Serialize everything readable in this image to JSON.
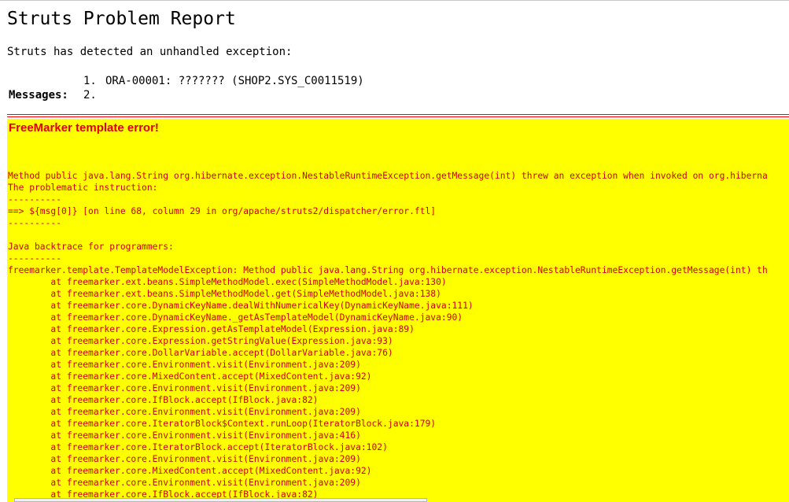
{
  "page": {
    "title": "Struts Problem Report",
    "intro": "Struts has detected an unhandled exception:",
    "messages_label": "Messages:",
    "messages": [
      {
        "num": "1.",
        "text": "ORA-00001: ??????? (SHOP2.SYS_C0011519)"
      },
      {
        "num": "2.",
        "text": ""
      }
    ]
  },
  "freemarker": {
    "heading": "FreeMarker template error!",
    "background_color": "#ffff00",
    "text_color": "#d00000",
    "lines": [
      "Method public java.lang.String org.hibernate.exception.NestableRuntimeException.getMessage(int) threw an exception when invoked on org.hiberna",
      "The problematic instruction:",
      "----------",
      "==> ${msg[0]} [on line 68, column 29 in org/apache/struts2/dispatcher/error.ftl]",
      "----------",
      "",
      "Java backtrace for programmers:",
      "----------",
      "freemarker.template.TemplateModelException: Method public java.lang.String org.hibernate.exception.NestableRuntimeException.getMessage(int) th",
      "        at freemarker.ext.beans.SimpleMethodModel.exec(SimpleMethodModel.java:130)",
      "        at freemarker.ext.beans.SimpleMethodModel.get(SimpleMethodModel.java:138)",
      "        at freemarker.core.DynamicKeyName.dealWithNumericalKey(DynamicKeyName.java:111)",
      "        at freemarker.core.DynamicKeyName._getAsTemplateModel(DynamicKeyName.java:90)",
      "        at freemarker.core.Expression.getAsTemplateModel(Expression.java:89)",
      "        at freemarker.core.Expression.getStringValue(Expression.java:93)",
      "        at freemarker.core.DollarVariable.accept(DollarVariable.java:76)",
      "        at freemarker.core.Environment.visit(Environment.java:209)",
      "        at freemarker.core.MixedContent.accept(MixedContent.java:92)",
      "        at freemarker.core.Environment.visit(Environment.java:209)",
      "        at freemarker.core.IfBlock.accept(IfBlock.java:82)",
      "        at freemarker.core.Environment.visit(Environment.java:209)",
      "        at freemarker.core.IteratorBlock$Context.runLoop(IteratorBlock.java:179)",
      "        at freemarker.core.Environment.visit(Environment.java:416)",
      "        at freemarker.core.IteratorBlock.accept(IteratorBlock.java:102)",
      "        at freemarker.core.Environment.visit(Environment.java:209)",
      "        at freemarker.core.MixedContent.accept(MixedContent.java:92)",
      "        at freemarker.core.Environment.visit(Environment.java:209)",
      "        at freemarker.core.IfBlock.accept(IfBlock.java:82)"
    ]
  }
}
